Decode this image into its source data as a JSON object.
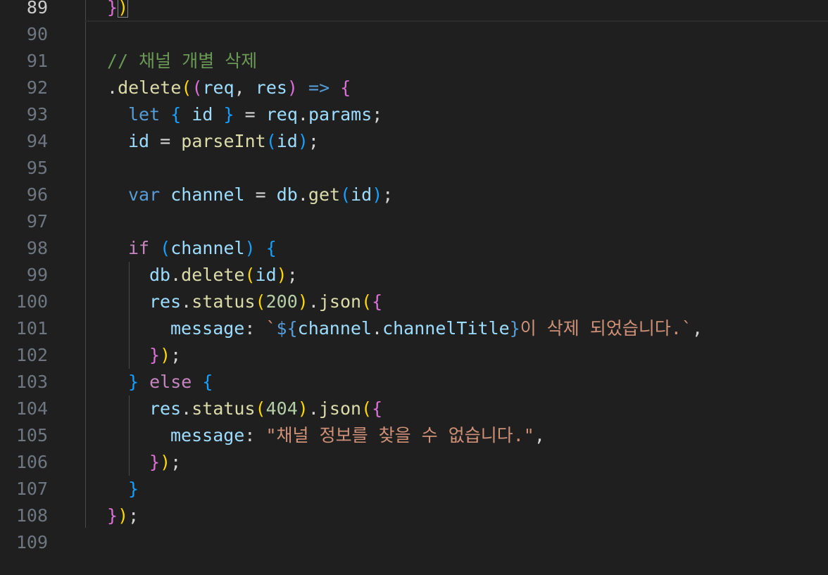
{
  "lines": [
    {
      "n": "89",
      "t": "})"
    },
    {
      "n": "90",
      "t": ""
    },
    {
      "n": "91",
      "t": "// 채널 개별 삭제"
    },
    {
      "n": "92",
      "t": ".delete((req, res) => {"
    },
    {
      "n": "93",
      "t": "let { id } = req.params;"
    },
    {
      "n": "94",
      "t": "id = parseInt(id);"
    },
    {
      "n": "95",
      "t": ""
    },
    {
      "n": "96",
      "t": "var channel = db.get(id);"
    },
    {
      "n": "97",
      "t": ""
    },
    {
      "n": "98",
      "t": "if (channel) {"
    },
    {
      "n": "99",
      "t": "db.delete(id);"
    },
    {
      "n": "100",
      "t": "res.status(200).json({"
    },
    {
      "n": "101",
      "t": "message: `${channel.channelTitle}이 삭제 되었습니다.`,"
    },
    {
      "n": "102",
      "t": "});"
    },
    {
      "n": "103",
      "t": "} else {"
    },
    {
      "n": "104",
      "t": "res.status(404).json({"
    },
    {
      "n": "105",
      "t": "message: \"채널 정보를 찾을 수 없습니다.\","
    },
    {
      "n": "106",
      "t": "});"
    },
    {
      "n": "107",
      "t": "}"
    },
    {
      "n": "108",
      "t": "});"
    },
    {
      "n": "109",
      "t": ""
    }
  ],
  "tokens": {
    "comment": "// 채널 개별 삭제",
    "delete_method": "delete",
    "req": "req",
    "res": "res",
    "arrow": "=>",
    "let": "let",
    "id": "id",
    "params": "params",
    "parseInt": "parseInt",
    "var": "var",
    "channel": "channel",
    "db": "db",
    "get": "get",
    "if": "if",
    "status": "status",
    "json": "json",
    "n200": "200",
    "n404": "404",
    "message": "message",
    "channelTitle": "channelTitle",
    "msg_deleted_suffix": "이 삭제 되었습니다.",
    "msg_not_found": "\"채널 정보를 찾을 수 없습니다.\"",
    "else": "else"
  },
  "colors": {
    "background": "#1f1f1f",
    "comment": "#6a9955",
    "keyword": "#569cd6",
    "control": "#c586c0",
    "variable": "#9cdcfe",
    "function": "#dcdcaa",
    "string": "#ce9178",
    "number": "#b5cea8",
    "bracket1": "#ffd700",
    "bracket2": "#da70d6",
    "bracket3": "#179fff"
  }
}
